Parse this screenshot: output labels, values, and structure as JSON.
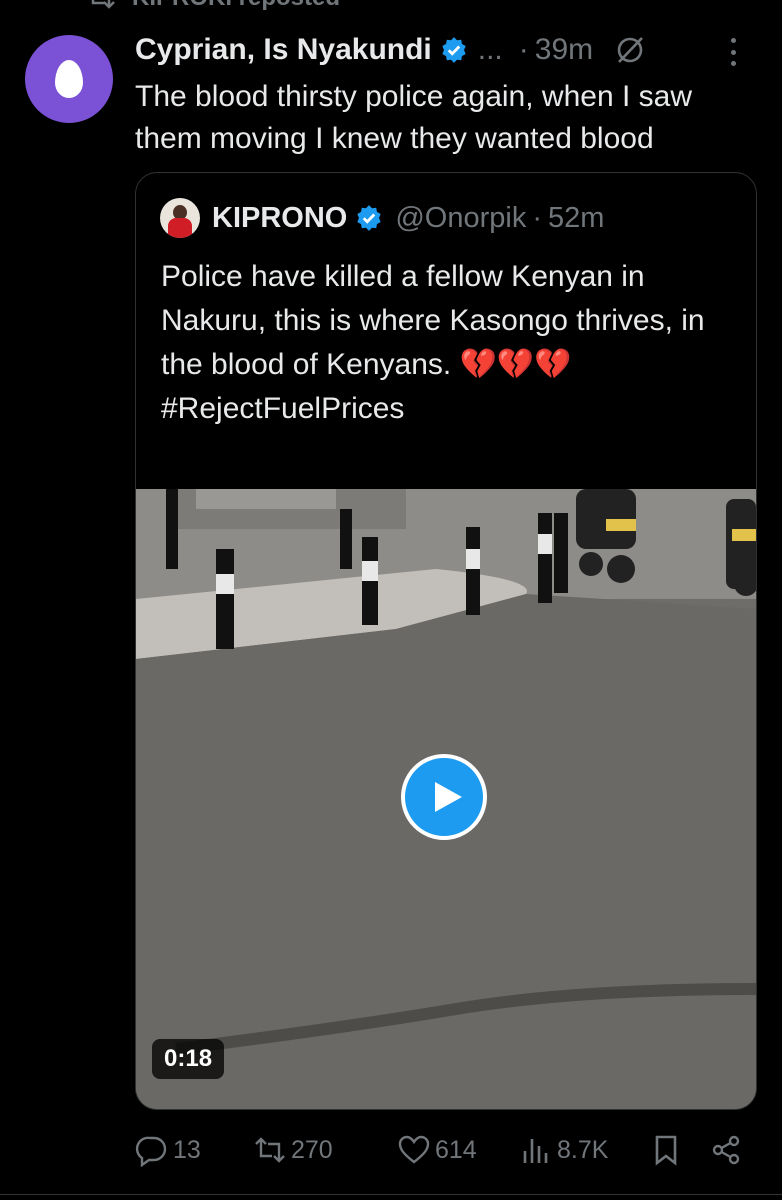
{
  "repost_banner": {
    "text": "KIPROKI reposted"
  },
  "post": {
    "author": "Cyprian, Is Nyakundi",
    "truncation": "...",
    "separator": "·",
    "time": "39m",
    "text": "The blood thirsty police again, when I saw them moving I knew they wanted blood"
  },
  "quoted_post": {
    "name": "KIPRONO",
    "handle": "@Onorpik",
    "separator": "·",
    "time": "52m",
    "text_line1": "Police have killed a fellow Kenyan in Nakuru, this is where Kasongo thrives, in the blood of Kenyans. 💔💔💔",
    "hashtag": "#RejectFuelPrices",
    "video": {
      "duration": "0:18"
    }
  },
  "actions": {
    "replies": "13",
    "reposts": "270",
    "likes": "614",
    "views": "8.7K"
  },
  "colors": {
    "background": "#000000",
    "text": "#e7e9ea",
    "muted": "#71767b",
    "accent": "#1d9bf0",
    "avatar": "#7b52d6"
  },
  "icons": [
    "repost-icon",
    "verified-badge-icon",
    "grok-icon",
    "more-icon",
    "play-icon",
    "reply-icon",
    "like-icon",
    "views-icon",
    "bookmark-icon",
    "share-icon"
  ]
}
